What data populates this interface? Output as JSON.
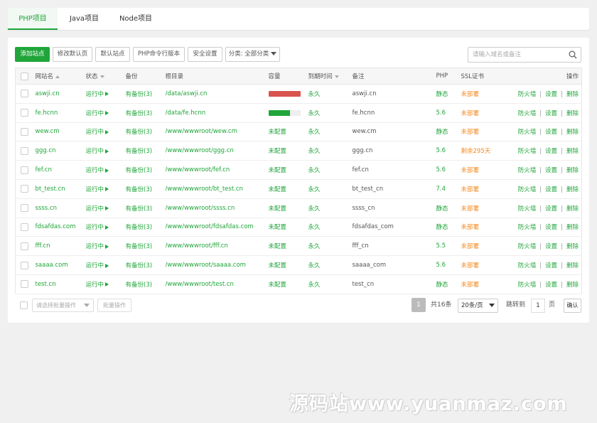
{
  "tabs": [
    "PHP项目",
    "Java项目",
    "Node项目"
  ],
  "toolbar": {
    "add_site": "添加站点",
    "modify_default_page": "修改默认页",
    "default_site": "默认站点",
    "php_cli_version": "PHP命令行版本",
    "security_settings": "安全设置",
    "category_select": "分类: 全部分类"
  },
  "search": {
    "placeholder": "请输入域名或备注"
  },
  "columns": {
    "site_name": "网站名",
    "status": "状态",
    "backup": "备份",
    "root_dir": "根目录",
    "capacity": "容量",
    "expire": "到期时间",
    "remark": "备注",
    "php": "PHP",
    "ssl": "SSL证书",
    "ops": "操作"
  },
  "ops_labels": {
    "firewall": "防火墙",
    "settings": "设置",
    "delete": "删除"
  },
  "rows": [
    {
      "name": "aswji.cn",
      "status": "运行中",
      "backup": "有备份(3)",
      "dir": "/data/aswji.cn",
      "quota_text": "",
      "quota_fill": 1.0,
      "quota_color": "#d9534f",
      "expire": "永久",
      "remark": "aswji.cn",
      "php": "静态",
      "ssl": "未部署"
    },
    {
      "name": "fe.hcnn",
      "status": "运行中",
      "backup": "有备份(3)",
      "dir": "/data/fe.hcnn",
      "quota_text": "",
      "quota_fill": 0.68,
      "quota_color": "#20a53a",
      "expire": "永久",
      "remark": "fe.hcnn",
      "php": "5.6",
      "ssl": "未部署"
    },
    {
      "name": "wew.cm",
      "status": "运行中",
      "backup": "有备份(3)",
      "dir": "/www/wwwroot/wew.cm",
      "quota_text": "未配置",
      "expire": "永久",
      "remark": "wew.cm",
      "php": "静态",
      "ssl": "未部署"
    },
    {
      "name": "ggg.cn",
      "status": "运行中",
      "backup": "有备份(3)",
      "dir": "/www/wwwroot/ggg.cn",
      "quota_text": "未配置",
      "expire": "永久",
      "remark": "ggg.cn",
      "php": "5.6",
      "ssl": "剩余295天"
    },
    {
      "name": "fef.cn",
      "status": "运行中",
      "backup": "有备份(3)",
      "dir": "/www/wwwroot/fef.cn",
      "quota_text": "未配置",
      "expire": "永久",
      "remark": "fef.cn",
      "php": "5.6",
      "ssl": "未部署"
    },
    {
      "name": "bt_test.cn",
      "status": "运行中",
      "backup": "有备份(3)",
      "dir": "/www/wwwroot/bt_test.cn",
      "quota_text": "未配置",
      "expire": "永久",
      "remark": "bt_test_cn",
      "php": "7.4",
      "ssl": "未部署"
    },
    {
      "name": "ssss.cn",
      "status": "运行中",
      "backup": "有备份(3)",
      "dir": "/www/wwwroot/ssss.cn",
      "quota_text": "未配置",
      "expire": "永久",
      "remark": "ssss_cn",
      "php": "静态",
      "ssl": "未部署"
    },
    {
      "name": "fdsafdas.com",
      "status": "运行中",
      "backup": "有备份(3)",
      "dir": "/www/wwwroot/fdsafdas.com",
      "quota_text": "未配置",
      "expire": "永久",
      "remark": "fdsafdas_com",
      "php": "静态",
      "ssl": "未部署"
    },
    {
      "name": "fff.cn",
      "status": "运行中",
      "backup": "有备份(3)",
      "dir": "/www/wwwroot/fff.cn",
      "quota_text": "未配置",
      "expire": "永久",
      "remark": "fff_cn",
      "php": "5.5",
      "ssl": "未部署"
    },
    {
      "name": "saaaa.com",
      "status": "运行中",
      "backup": "有备份(3)",
      "dir": "/www/wwwroot/saaaa.com",
      "quota_text": "未配置",
      "expire": "永久",
      "remark": "saaaa_com",
      "php": "5.6",
      "ssl": "未部署"
    },
    {
      "name": "test.cn",
      "status": "运行中",
      "backup": "有备份(3)",
      "dir": "/www/wwwroot/test.cn",
      "quota_text": "未配置",
      "expire": "永久",
      "remark": "test_cn",
      "php": "静态",
      "ssl": "未部署"
    }
  ],
  "footer": {
    "batch_placeholder": "请选择批量操作",
    "batch_button": "批量操作",
    "current_page": "1",
    "total": "共16条",
    "per_page": "20条/页",
    "jump_to": "跳转到",
    "jump_value": "1",
    "page_unit": "页",
    "confirm": "确认"
  },
  "watermark": "源码站www.yuanmaz.com",
  "colors": {
    "accent": "#20a53a",
    "warning": "#f7891d",
    "danger": "#d9534f"
  }
}
